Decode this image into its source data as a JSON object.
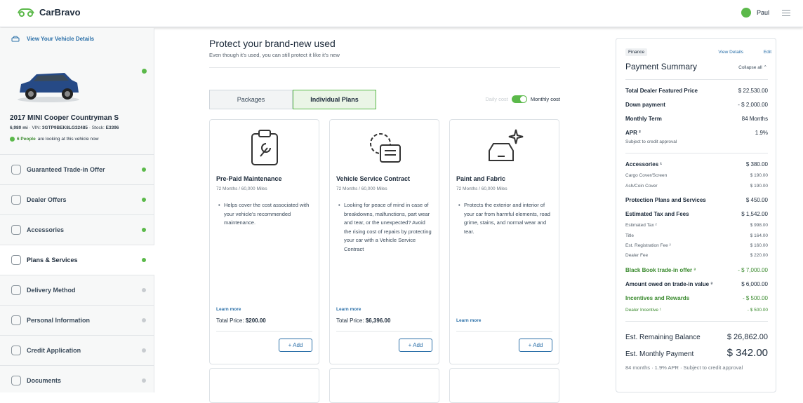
{
  "header": {
    "brand": "CarBravo",
    "user": "Paul"
  },
  "sidebar": {
    "view_details": "View Your Vehicle Details",
    "vehicle_title": "2017 MINI Cooper Countryman S",
    "miles": "6,980 mi",
    "vin_label": "VIN:",
    "vin": "3GTP9BEK8LG32485",
    "stock_label": "Stock:",
    "stock": "E3396",
    "people_count": "6 People",
    "people_text": " are looking at this vehicle now",
    "items": [
      {
        "label": "Guaranteed Trade-in Offer",
        "done": true
      },
      {
        "label": "Dealer Offers",
        "done": true
      },
      {
        "label": "Accessories",
        "done": true
      },
      {
        "label": "Plans & Services",
        "done": true
      },
      {
        "label": "Delivery Method",
        "done": false
      },
      {
        "label": "Personal Information",
        "done": false
      },
      {
        "label": "Credit Application",
        "done": false
      },
      {
        "label": "Documents",
        "done": false
      }
    ]
  },
  "main": {
    "title": "Protect your brand-new used",
    "subtitle": "Even though it's used, you can still protect it like it's new",
    "tabs": [
      "Packages",
      "Individual Plans"
    ],
    "toggle_off": "Daily cost",
    "toggle_on": "Monthly cost",
    "cards": [
      {
        "title": "Pre-Paid Maintenance",
        "duration": "72 Months / 60,000 Miles",
        "desc": "Helps cover the cost associated with your vehicle's recommended maintenance.",
        "learn": "Learn more",
        "price_label": "Total Price:",
        "price": "$200.00",
        "add": "+ Add"
      },
      {
        "title": "Vehicle Service Contract",
        "duration": "72 Months / 60,000 Miles",
        "desc": "Looking for peace of mind in case of breakdowns, malfunctions, part wear and tear, or the unexpected? Avoid the rising cost of repairs by protecting your car with a Vehicle Service Contract",
        "learn": "Learn more",
        "price_label": "Total Price:",
        "price": "$6,396.00",
        "add": "+ Add"
      },
      {
        "title": "Paint and Fabric",
        "duration": "72 Months / 60,000 Miles",
        "desc": "Protects the exterior and interior of your car from harmful elements, road grime, stains, and normal wear and tear.",
        "learn": "Learn more",
        "add": "+ Add"
      }
    ]
  },
  "summary": {
    "badge": "Finance",
    "view_details": "View Details",
    "edit": "Edit",
    "title": "Payment Summary",
    "collapse": "Collapse all",
    "rows": {
      "tdfp": {
        "l": "Total Dealer Featured Price",
        "v": "$ 22,530.00"
      },
      "down": {
        "l": "Down payment",
        "v": "- $ 2,000.00"
      },
      "term": {
        "l": "Monthly Term",
        "v": "84 Months"
      },
      "apr": {
        "l": "APR ²",
        "v": "1.9%"
      },
      "apr_note": "Subject to credit approval",
      "acc": {
        "l": "Accessories ¹",
        "v": "$ 380.00"
      },
      "cargo": {
        "l": "Cargo Cover/Screen",
        "v": "$ 190.00"
      },
      "ash": {
        "l": "Ash/Coin Cover",
        "v": "$ 190.00"
      },
      "prot": {
        "l": "Protection Plans and Services",
        "v": "$ 450.00"
      },
      "tax": {
        "l": "Estimated Tax and Fees",
        "v": "$ 1,542.00"
      },
      "etax": {
        "l": "Estimated Tax ²",
        "v": "$ 998.00"
      },
      "titl": {
        "l": "Title",
        "v": "$ 164.00"
      },
      "reg": {
        "l": "Est. Registration Fee ²",
        "v": "$ 160.00"
      },
      "dfee": {
        "l": "Dealer Fee",
        "v": "$ 220.00"
      },
      "bb": {
        "l": "Black Book trade-in offer ³",
        "v": "- $ 7,000.00"
      },
      "owed": {
        "l": "Amount owed on trade-in value ³",
        "v": "$ 6,000.00"
      },
      "inc": {
        "l": "Incentives and Rewards",
        "v": "- $ 500.00"
      },
      "dinc": {
        "l": "Dealer Incentive ¹",
        "v": "- $ 500.00"
      }
    },
    "remaining_label": "Est. Remaining Balance",
    "remaining": "$ 26,862.00",
    "monthly_label": "Est. Monthly Payment",
    "monthly": "$ 342.00",
    "footer": "84 months · 1.9% APR · Subject to credit approval",
    "colors": {
      "accent": "#5bb94a",
      "link": "#2a6fa8"
    }
  }
}
